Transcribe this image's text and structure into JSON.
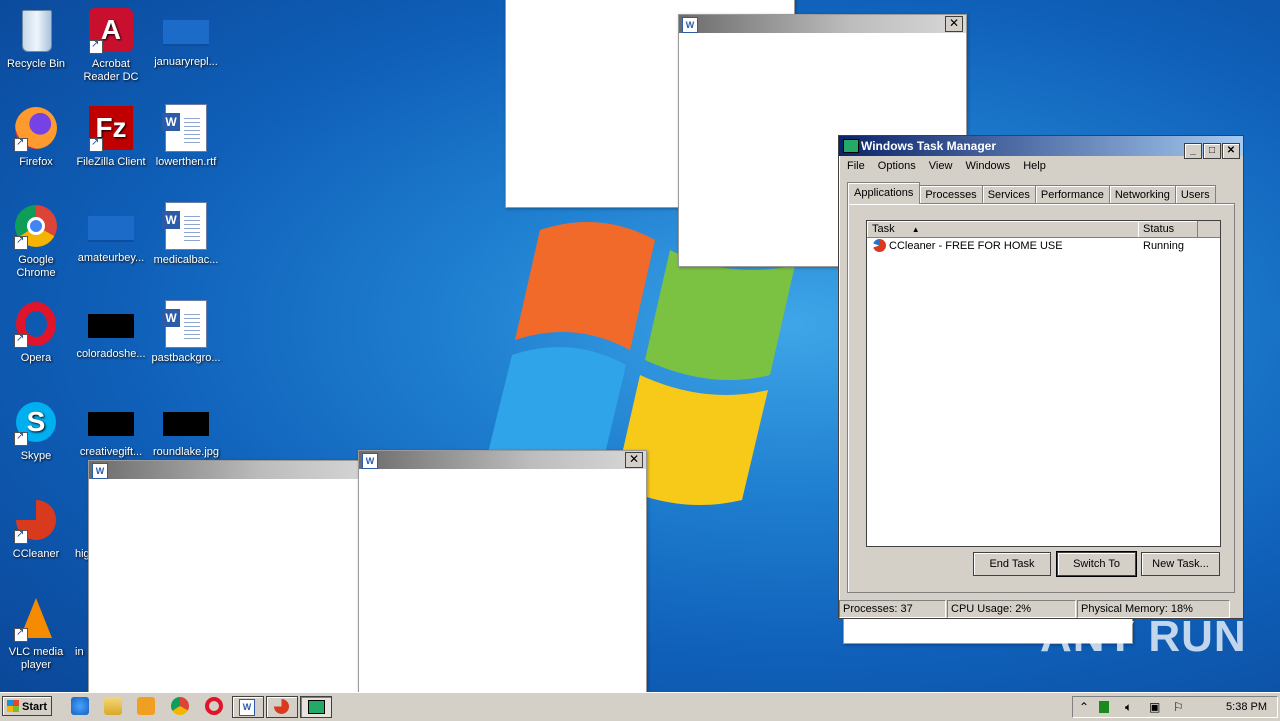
{
  "desktop": {
    "icons": [
      {
        "label": "Recycle Bin"
      },
      {
        "label": "Acrobat Reader DC"
      },
      {
        "label": "januaryrepl..."
      },
      {
        "label": "Firefox"
      },
      {
        "label": "FileZilla Client"
      },
      {
        "label": "lowerthen.rtf"
      },
      {
        "label": "Google Chrome"
      },
      {
        "label": "amateurbey..."
      },
      {
        "label": "medicalbac..."
      },
      {
        "label": "Opera"
      },
      {
        "label": "coloradoshe..."
      },
      {
        "label": "pastbackgro..."
      },
      {
        "label": "Skype"
      },
      {
        "label": "creativegift..."
      },
      {
        "label": "roundlake.jpg"
      },
      {
        "label": "CCleaner"
      },
      {
        "label": "hig"
      },
      {
        "label": "VLC media player"
      },
      {
        "label": "in"
      }
    ]
  },
  "task_manager": {
    "title": "Windows Task Manager",
    "menu": [
      "File",
      "Options",
      "View",
      "Windows",
      "Help"
    ],
    "tabs": [
      "Applications",
      "Processes",
      "Services",
      "Performance",
      "Networking",
      "Users"
    ],
    "active_tab": "Applications",
    "columns": [
      "Task",
      "Status"
    ],
    "rows": [
      {
        "task": "CCleaner - FREE FOR HOME USE",
        "status": "Running"
      }
    ],
    "buttons": {
      "end_task": "End Task",
      "switch_to": "Switch To",
      "new_task": "New Task..."
    },
    "status": {
      "processes": "Processes: 37",
      "cpu": "CPU Usage: 2%",
      "memory": "Physical Memory: 18%"
    }
  },
  "taskbar": {
    "start_label": "Start",
    "clock": "5:38 PM"
  },
  "watermark": "ANY RUN",
  "colors": {
    "title_active": "#0a246a",
    "title_gradient_end": "#a6caf0",
    "chrome": "#d4d0c8"
  }
}
